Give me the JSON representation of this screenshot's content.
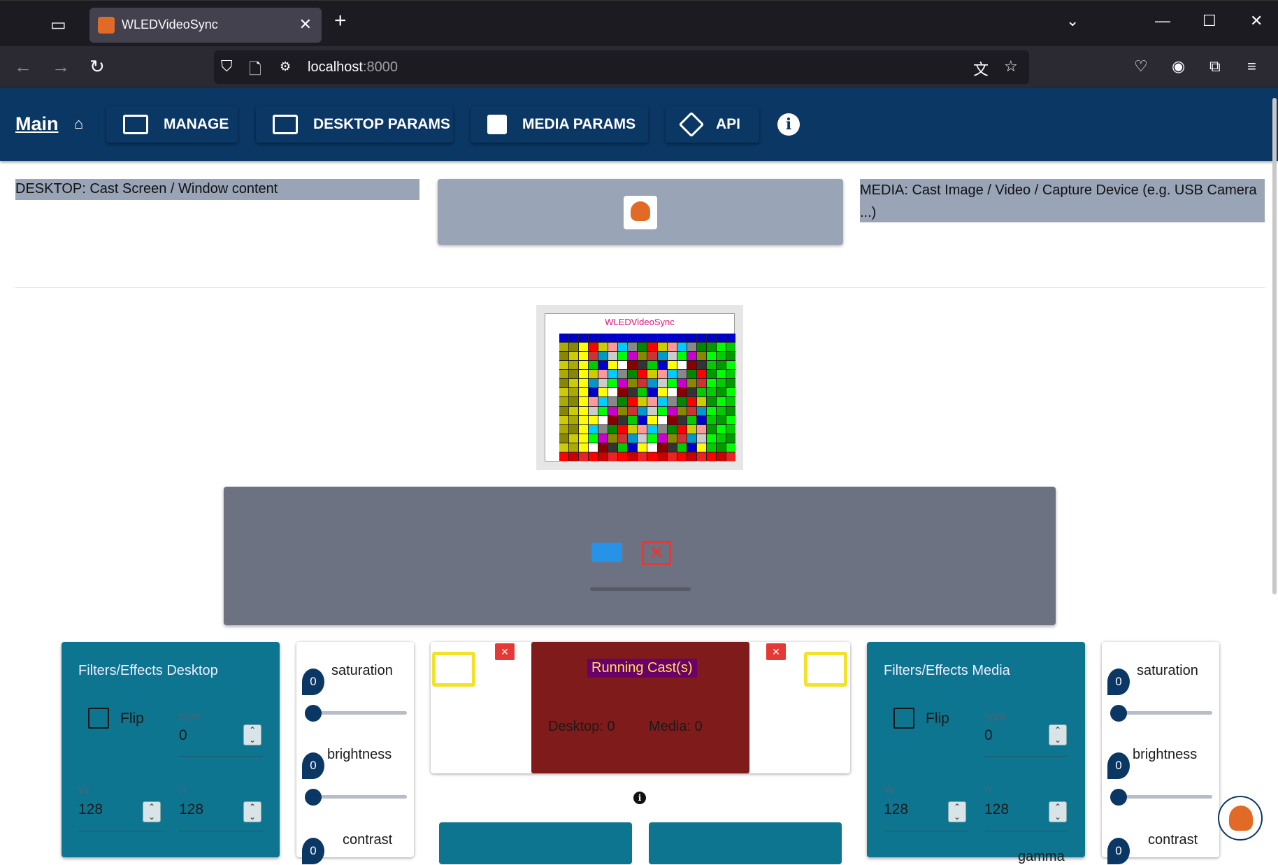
{
  "browser": {
    "tab_title": "WLEDVideoSync",
    "tab_close": "✕",
    "new_tab": "+",
    "url_host": "localhost",
    "url_port": ":8000"
  },
  "appbar": {
    "main_label": "Main",
    "nav": [
      {
        "label": "MANAGE",
        "icon": "manage-icon"
      },
      {
        "label": "DESKTOP PARAMS",
        "icon": "laptop-icon"
      },
      {
        "label": "MEDIA PARAMS",
        "icon": "image-icon"
      },
      {
        "label": "API",
        "icon": "api-icon"
      }
    ],
    "info": "i"
  },
  "labels": {
    "desktop": "DESKTOP: Cast Screen / Window content",
    "media": "MEDIA: Cast Image / Video / Capture Device (e.g. USB Camera ...)"
  },
  "preview": {
    "title": "WLEDVideoSync"
  },
  "cast_panel": {
    "stop_symbol": "✕"
  },
  "filters_desktop": {
    "title": "Filters/Effects Desktop",
    "flip_label": "Flip",
    "type_label": "type",
    "type_value": "0",
    "w_label": "W",
    "w_value": "128",
    "h_label": "H",
    "h_value": "128"
  },
  "filters_media": {
    "title": "Filters/Effects Media",
    "flip_label": "Flip",
    "type_label": "type",
    "type_value": "0",
    "w_label": "W",
    "w_value": "128",
    "h_label": "H",
    "h_value": "128",
    "gamma_partial": "gamma"
  },
  "sliders_desktop": {
    "saturation_label": "saturation",
    "saturation_value": "0",
    "brightness_label": "brightness",
    "brightness_value": "0",
    "contrast_label": "contrast",
    "contrast_value": "0"
  },
  "sliders_media": {
    "saturation_label": "saturation",
    "saturation_value": "0",
    "brightness_label": "brightness",
    "brightness_value": "0",
    "contrast_label": "contrast",
    "contrast_value": "0"
  },
  "running": {
    "title": "Running Cast(s)",
    "desktop_count": "Desktop: 0",
    "media_count": "Media: 0"
  },
  "colors": {
    "appbar": "#0b3764",
    "filter_card": "#0e7590",
    "running_panel": "#801b1b",
    "running_title_bg": "#6a006a",
    "running_title_fg": "#ffe14a"
  }
}
